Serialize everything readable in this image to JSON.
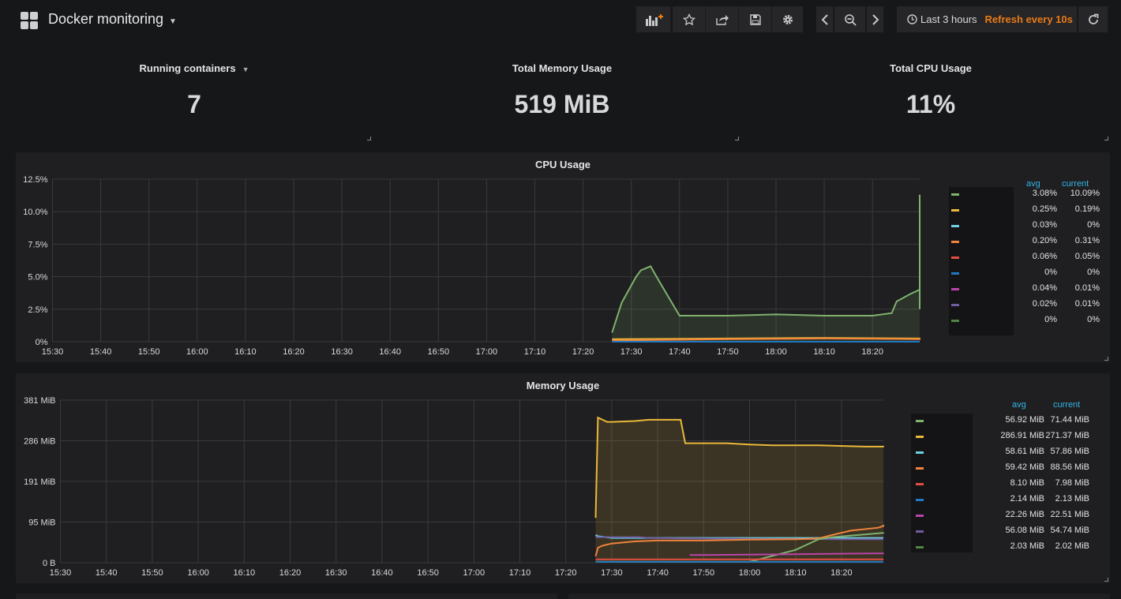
{
  "header": {
    "dashboard_title": "Docker monitoring",
    "time_range": "Last 3 hours",
    "refresh": "Refresh every 10s"
  },
  "stats": [
    {
      "title": "Running containers",
      "value": "7"
    },
    {
      "title": "Total Memory Usage",
      "value": "519 MiB"
    },
    {
      "title": "Total CPU Usage",
      "value": "11%"
    }
  ],
  "cpu_panel": {
    "title": "CPU Usage",
    "legend_headers": {
      "avg": "avg",
      "current": "current"
    },
    "legend": [
      {
        "color": "#7eb26d",
        "avg": "3.08%",
        "current": "10.09%"
      },
      {
        "color": "#eab839",
        "avg": "0.25%",
        "current": "0.19%"
      },
      {
        "color": "#6ed0e0",
        "avg": "0.03%",
        "current": "0%"
      },
      {
        "color": "#ef843c",
        "avg": "0.20%",
        "current": "0.31%"
      },
      {
        "color": "#e24d42",
        "avg": "0.06%",
        "current": "0.05%"
      },
      {
        "color": "#1f78c1",
        "avg": "0%",
        "current": "0%"
      },
      {
        "color": "#ba43a9",
        "avg": "0.04%",
        "current": "0.01%"
      },
      {
        "color": "#705da0",
        "avg": "0.02%",
        "current": "0.01%"
      },
      {
        "color": "#508642",
        "avg": "0%",
        "current": "0%"
      }
    ]
  },
  "memory_panel": {
    "title": "Memory Usage",
    "legend_headers": {
      "avg": "avg",
      "current": "current"
    },
    "legend": [
      {
        "color": "#7eb26d",
        "avg": "56.92 MiB",
        "current": "71.44 MiB"
      },
      {
        "color": "#eab839",
        "avg": "286.91 MiB",
        "current": "271.37 MiB"
      },
      {
        "color": "#6ed0e0",
        "avg": "58.61 MiB",
        "current": "57.86 MiB"
      },
      {
        "color": "#ef843c",
        "avg": "59.42 MiB",
        "current": "88.56 MiB"
      },
      {
        "color": "#e24d42",
        "avg": "8.10 MiB",
        "current": "7.98 MiB"
      },
      {
        "color": "#1f78c1",
        "avg": "2.14 MiB",
        "current": "2.13 MiB"
      },
      {
        "color": "#ba43a9",
        "avg": "22.26 MiB",
        "current": "22.51 MiB"
      },
      {
        "color": "#705da0",
        "avg": "56.08 MiB",
        "current": "54.74 MiB"
      },
      {
        "color": "#508642",
        "avg": "2.03 MiB",
        "current": "2.02 MiB"
      }
    ]
  },
  "chart_data": [
    {
      "type": "line",
      "title": "CPU Usage",
      "x_ticks": [
        "15:30",
        "15:40",
        "15:50",
        "16:00",
        "16:10",
        "16:20",
        "16:30",
        "16:40",
        "16:50",
        "17:00",
        "17:10",
        "17:20",
        "17:30",
        "17:40",
        "17:50",
        "18:00",
        "18:10",
        "18:20"
      ],
      "y_ticks": [
        "0%",
        "2.5%",
        "5.0%",
        "7.5%",
        "10.0%",
        "12.5%"
      ],
      "ylim": [
        0,
        12.5
      ],
      "x_range_minutes": [
        0,
        179
      ],
      "grid": true,
      "series": [
        {
          "color": "#7eb26d",
          "fill": true,
          "x": [
            116,
            118,
            121,
            122,
            124,
            126,
            130,
            140,
            150,
            160,
            165,
            170,
            174,
            175,
            176,
            178,
            180,
            181,
            183,
            186,
            188,
            192,
            195,
            197,
            198,
            199
          ],
          "y": [
            0.7,
            3.0,
            5.0,
            5.5,
            5.8,
            4.5,
            2.0,
            2.0,
            2.1,
            2.0,
            2.0,
            2.0,
            2.2,
            3.1,
            3.3,
            3.7,
            4.0,
            3.4,
            2.6,
            2.5,
            2.5,
            4.0,
            8.5,
            11.2,
            11.3,
            10.1
          ]
        },
        {
          "color": "#eab839",
          "fill": false,
          "x": [
            116,
            140,
            160,
            180,
            199
          ],
          "y": [
            0.2,
            0.25,
            0.3,
            0.25,
            0.19
          ]
        },
        {
          "color": "#ef843c",
          "fill": false,
          "x": [
            116,
            140,
            160,
            180,
            199
          ],
          "y": [
            0.1,
            0.2,
            0.25,
            0.2,
            0.31
          ]
        },
        {
          "color": "#1f78c1",
          "fill": false,
          "x": [
            116,
            199
          ],
          "y": [
            0.0,
            0.0
          ]
        }
      ]
    },
    {
      "type": "line",
      "title": "Memory Usage",
      "x_ticks": [
        "15:30",
        "15:40",
        "15:50",
        "16:00",
        "16:10",
        "16:20",
        "16:30",
        "16:40",
        "16:50",
        "17:00",
        "17:10",
        "17:20",
        "17:30",
        "17:40",
        "17:50",
        "18:00",
        "18:10",
        "18:20"
      ],
      "y_ticks": [
        "0 B",
        "95 MiB",
        "191 MiB",
        "286 MiB",
        "381 MiB"
      ],
      "ylim": [
        0,
        381
      ],
      "grid": true,
      "series": [
        {
          "color": "#eab839",
          "fill": true,
          "x": [
            116.5,
            117,
            118,
            119,
            120,
            125,
            128,
            134,
            135,
            136,
            140,
            145,
            150,
            155,
            160,
            165,
            175,
            180,
            185,
            190,
            189.5
          ],
          "y": [
            105,
            340,
            335,
            330,
            330,
            332,
            335,
            335,
            335,
            280,
            280,
            280,
            277,
            275,
            275,
            275,
            272,
            272,
            271,
            271,
            271
          ]
        },
        {
          "color": "#6ed0e0",
          "fill": false,
          "x": [
            116.5,
            117,
            120,
            125,
            128,
            150,
            189.5
          ],
          "y": [
            65,
            62,
            58,
            58,
            58,
            58,
            58
          ]
        },
        {
          "color": "#705da0",
          "fill": false,
          "x": [
            116.5,
            120,
            126,
            128,
            135,
            150,
            170,
            189.5
          ],
          "y": [
            60,
            60,
            60,
            58,
            57,
            56,
            55,
            55
          ]
        },
        {
          "color": "#ef843c",
          "fill": false,
          "x": [
            116.5,
            117,
            118,
            120,
            125,
            130,
            140,
            150,
            160,
            165,
            168,
            172,
            178,
            183,
            189.5
          ],
          "y": [
            15,
            35,
            40,
            45,
            50,
            52,
            52,
            54,
            55,
            57,
            65,
            75,
            82,
            86,
            89
          ]
        },
        {
          "color": "#7eb26d",
          "fill": false,
          "x": [
            116.5,
            150,
            160,
            165,
            168,
            175,
            183,
            189.5
          ],
          "y": [
            2,
            2,
            30,
            55,
            60,
            66,
            70,
            71
          ]
        },
        {
          "color": "#ba43a9",
          "fill": false,
          "x": [
            137,
            140,
            150,
            160,
            170,
            180,
            185,
            189.5
          ],
          "y": [
            18,
            18,
            19,
            20,
            21,
            22,
            22,
            22.5
          ]
        },
        {
          "color": "#e24d42",
          "fill": false,
          "x": [
            116.5,
            189.5
          ],
          "y": [
            8,
            8
          ]
        },
        {
          "color": "#1f78c1",
          "fill": false,
          "x": [
            116.5,
            189.5
          ],
          "y": [
            2,
            2
          ]
        }
      ]
    }
  ]
}
